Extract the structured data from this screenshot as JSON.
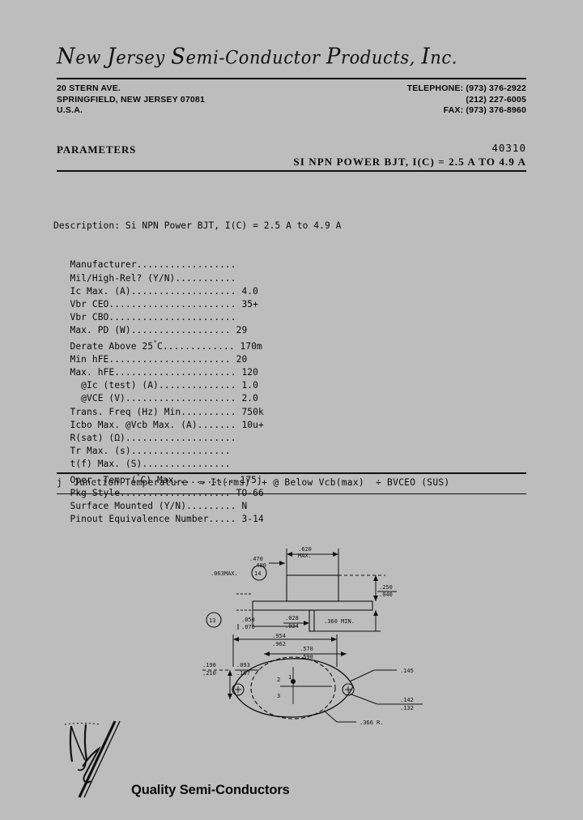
{
  "letterhead": {
    "company": "New Jersey Semi-Conductor Products, Inc.",
    "address_lines": [
      "20 STERN AVE.",
      "SPRINGFIELD, NEW JERSEY 07081",
      "U.S.A."
    ],
    "contact_lines": [
      "TELEPHONE: (973) 376-2922",
      "(212) 227-6005",
      "FAX: (973) 376-8960"
    ]
  },
  "titleblock": {
    "parameters_label": "PARAMETERS",
    "part_number": "40310",
    "subtitle": "SI NPN POWER BJT, I(C) = 2.5 A TO 4.9 A"
  },
  "spec": {
    "description_label": "Description:",
    "description_value": "Si NPN Power BJT, I(C) = 2.5 A to 4.9 A",
    "rows": [
      {
        "label": "Manufacturer",
        "dots": "..................",
        "value": ""
      },
      {
        "label": "Mil/High-Rel? (Y/N)",
        "dots": "...........",
        "value": ""
      },
      {
        "label": "Ic Max. (A)",
        "dots": "...................",
        "value": "4.0"
      },
      {
        "label": "Vbr CEO",
        "dots": ".......................",
        "value": "35+"
      },
      {
        "label": "Vbr CBO",
        "dots": ".......................",
        "value": ""
      },
      {
        "label": "Max. PD (W)",
        "dots": "..................",
        "value": "29"
      },
      {
        "label": "Derate Above 25",
        "dots": "C.............",
        "value": "170m",
        "degree": true
      },
      {
        "label": "Min hFE",
        "dots": "......................",
        "value": "20"
      },
      {
        "label": "Max. hFE",
        "dots": "......................",
        "value": "120"
      },
      {
        "label": "  @Ic (test) (A)",
        "dots": "..............",
        "value": "1.0"
      },
      {
        "label": "  @VCE (V)",
        "dots": "....................",
        "value": "2.0"
      },
      {
        "label": "Trans. Freq (Hz) Min",
        "dots": "..........",
        "value": "750k"
      },
      {
        "label": "Icbo Max. @Vcb Max. (A)",
        "dots": ".......",
        "value": "10u+"
      },
      {
        "label": "R(sat) (Ω)",
        "dots": "....................",
        "value": ""
      },
      {
        "label": "Tr Max. (s)",
        "dots": "..................",
        "value": ""
      },
      {
        "label": "t(f) Max. (S)",
        "dots": "................",
        "value": ""
      },
      {
        "label": "Oper. Temp (",
        "dots": "C) Max...........",
        "value": "175j",
        "degree": true
      },
      {
        "label": "Pkg Style",
        "dots": "....................",
        "value": "TO-66"
      },
      {
        "label": "Surface Mounted (Y/N)",
        "dots": ".........",
        "value": "N"
      },
      {
        "label": "Pinout Equivalence Number",
        "dots": ".....",
        "value": "3-14"
      }
    ]
  },
  "legend": {
    "text": "j  Junction Temperature  ≈ It(rms)  + @ Below Vcb(max)  ÷ BVCEO (SUS)"
  },
  "drawing": {
    "package": "TO-66",
    "dimensions": {
      "top_width_max": ".620 MAX.",
      "cap_height": ".470 / .400",
      "flange_thickness": ".063 MAX.",
      "seating_height": ".250 / .040",
      "lead_length_min": ".360 MIN.",
      "flange_edge": ".050 / .076",
      "lead_dia": ".028 / .034",
      "mount_span": ".954 / .962",
      "hole_span": ".570 / .590",
      "tab_height": ".190 / .210",
      "tab_width": ".093 / .107",
      "pin_circle": ".145",
      "pin_dia": ".142 / .132",
      "corner_radius": ".366 R."
    },
    "note_markers": [
      "13",
      "14"
    ],
    "pin_labels": [
      "2",
      "1",
      "3"
    ]
  },
  "footer": {
    "tagline": "Quality Semi-Conductors",
    "logo_name": "njs-logo"
  },
  "colors": {
    "background": "#bdbdbd",
    "ink": "#0a0a0a"
  }
}
